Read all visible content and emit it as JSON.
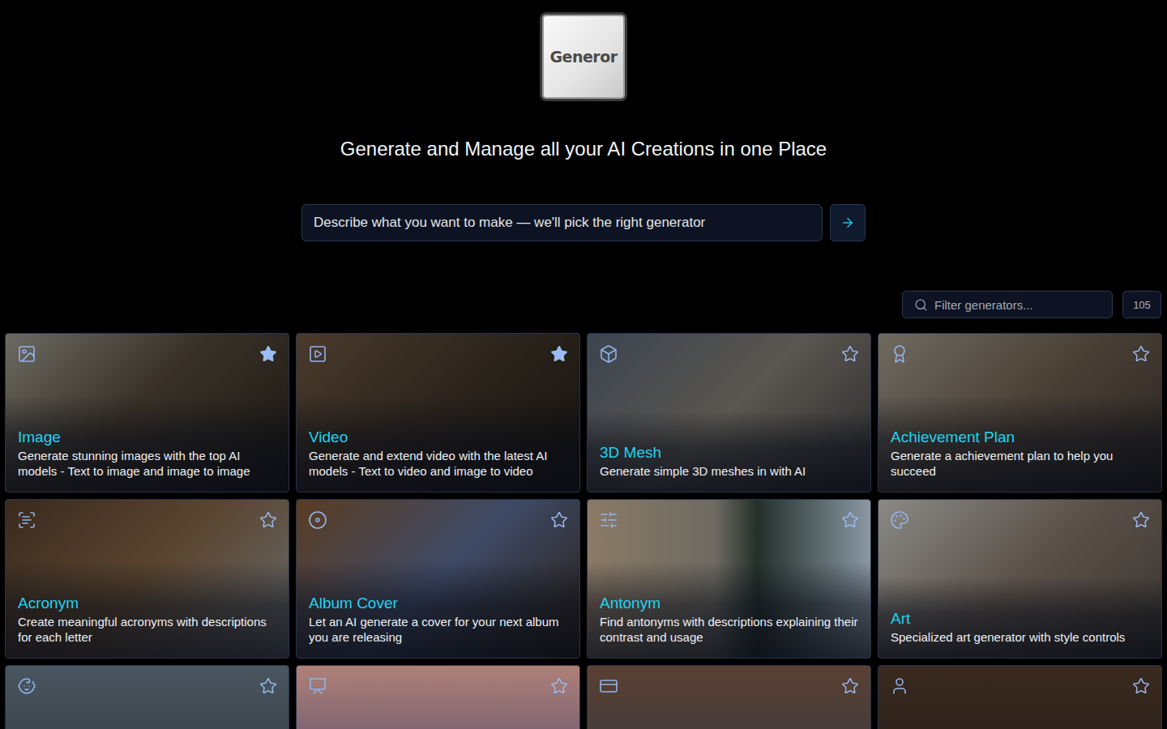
{
  "logo": {
    "text": "Generor"
  },
  "headline": "Generate and Manage all your AI Creations in one Place",
  "prompt": {
    "placeholder": "Describe what you want to make — we'll pick the right generator"
  },
  "filter": {
    "placeholder": "Filter generators...",
    "count": "105"
  },
  "generators": [
    {
      "title": "Image",
      "description": "Generate stunning images with the top AI models - Text to image and image to image",
      "favorite": true
    },
    {
      "title": "Video",
      "description": "Generate and extend video with the latest AI models - Text to video and image to video",
      "favorite": true
    },
    {
      "title": "3D Mesh",
      "description": "Generate simple 3D meshes in with AI",
      "favorite": false
    },
    {
      "title": "Achievement Plan",
      "description": "Generate a achievement plan to help you succeed",
      "favorite": false
    },
    {
      "title": "Acronym",
      "description": "Create meaningful acronyms with descriptions for each letter",
      "favorite": false
    },
    {
      "title": "Album Cover",
      "description": "Let an AI generate a cover for your next album you are releasing",
      "favorite": false
    },
    {
      "title": "Antonym",
      "description": "Find antonyms with descriptions explaining their contrast and usage",
      "favorite": false
    },
    {
      "title": "Art",
      "description": "Specialized art generator with style controls",
      "favorite": false
    },
    {
      "favorite": false
    },
    {
      "favorite": false
    },
    {
      "favorite": false
    },
    {
      "favorite": false
    }
  ]
}
